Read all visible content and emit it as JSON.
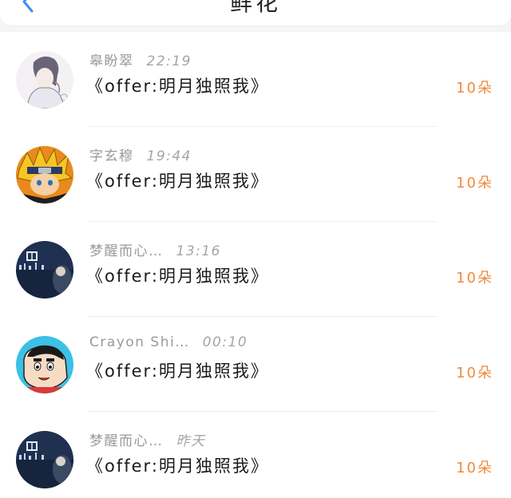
{
  "header": {
    "title": "鲜花",
    "back_icon": "chevron-left-icon",
    "accent": "#3d8ef0"
  },
  "colors": {
    "count_text": "#f08a3c",
    "name_text": "#9a9a9a",
    "gift_text": "#1a1a1a"
  },
  "list": {
    "items": [
      {
        "name": "皋盼翠",
        "time": "22:19",
        "gift": "《offer:明月独照我》",
        "count": "10朵",
        "avatar": "anime-sketch-avatar"
      },
      {
        "name": "字玄穆",
        "time": "19:44",
        "gift": "《offer:明月独照我》",
        "count": "10朵",
        "avatar": "naruto-avatar"
      },
      {
        "name": "梦醒而心…",
        "time": "13:16",
        "gift": "《offer:明月独照我》",
        "count": "10朵",
        "avatar": "night-city-avatar"
      },
      {
        "name": "Crayon Shi…",
        "time": "00:10",
        "gift": "《offer:明月独照我》",
        "count": "10朵",
        "avatar": "crayon-shin-chan-avatar"
      },
      {
        "name": "梦醒而心…",
        "time": "昨天",
        "gift": "《offer:明月独照我》",
        "count": "10朵",
        "avatar": "night-city-avatar"
      }
    ]
  }
}
